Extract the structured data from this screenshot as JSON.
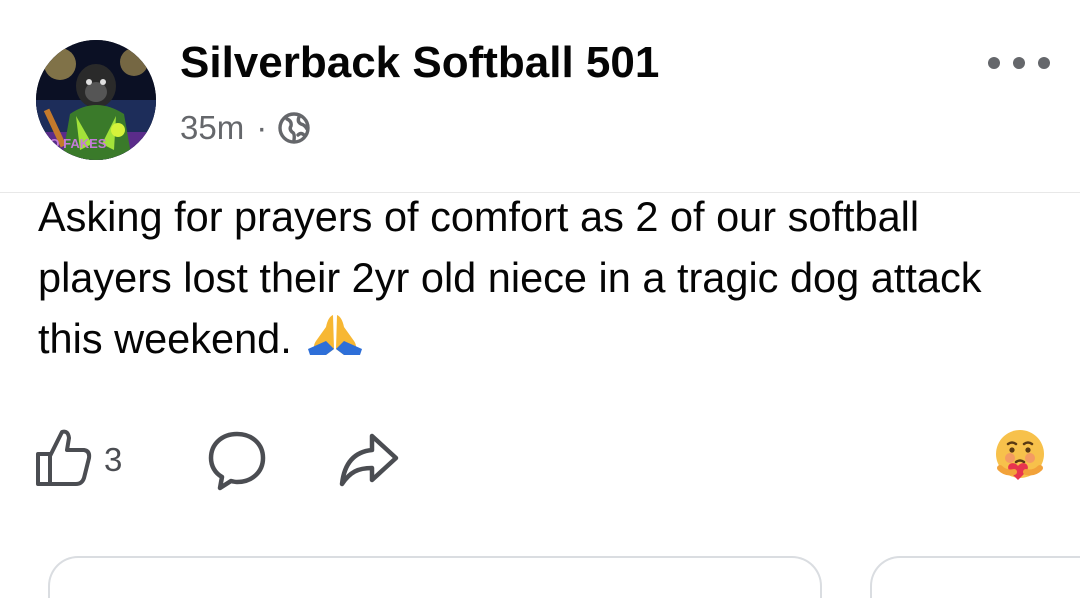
{
  "post": {
    "author": "Silverback Softball 501",
    "timestamp": "35m",
    "separator": "·",
    "privacy_icon": "globe-icon",
    "avatar_text": "NO FAKES",
    "text": "Asking for prayers of comfort as 2 of our softball players lost their 2yr old niece in a tragic dog attack this weekend.",
    "emoji": "folded-hands-emoji"
  },
  "actions": {
    "like_count": "3",
    "like_icon": "thumbs-up-icon",
    "comment_icon": "comment-icon",
    "share_icon": "share-icon",
    "reaction_icon": "care-emoji"
  },
  "menu": {
    "icon": "more-options-icon"
  },
  "colors": {
    "text": "#050505",
    "secondary": "#65676b",
    "divider": "#e8e8e8"
  }
}
